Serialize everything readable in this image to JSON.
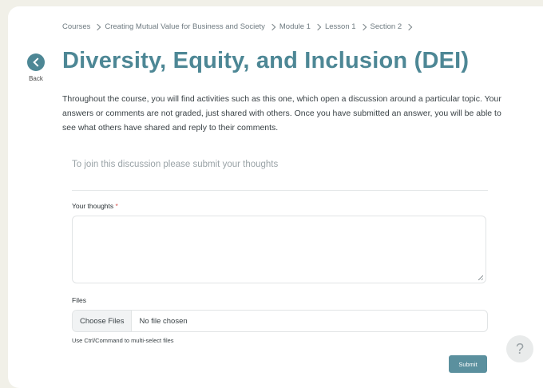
{
  "breadcrumb": {
    "items": [
      "Courses",
      "Creating Mutual Value for Business and Society",
      "Module 1",
      "Lesson 1",
      "Section 2"
    ]
  },
  "back": {
    "label": "Back",
    "icon": "chevron-left-icon"
  },
  "page": {
    "title": "Diversity, Equity, and Inclusion (DEI)",
    "intro": "Throughout the course, you will find activities such as this one, which open a discussion around a particular topic. Your answers or comments are not graded, just shared with others. Once you have submitted an answer, you will be able to see what others have shared and reply to their comments."
  },
  "discussion": {
    "join_prompt": "To join this discussion please submit your thoughts",
    "thoughts_label": "Your thoughts",
    "required_mark": "*",
    "thoughts_value": "",
    "files_label": "Files",
    "choose_files_label": "Choose Files",
    "no_file_text": "No file chosen",
    "multi_select_hint": "Use Ctrl/Command to multi-select files",
    "submit_label": "Submit"
  },
  "help": {
    "label": "?",
    "icon": "help-icon"
  },
  "colors": {
    "accent": "#4d8795",
    "background": "#f1f0e8",
    "submit": "#5b909e",
    "required": "#d9534f"
  }
}
